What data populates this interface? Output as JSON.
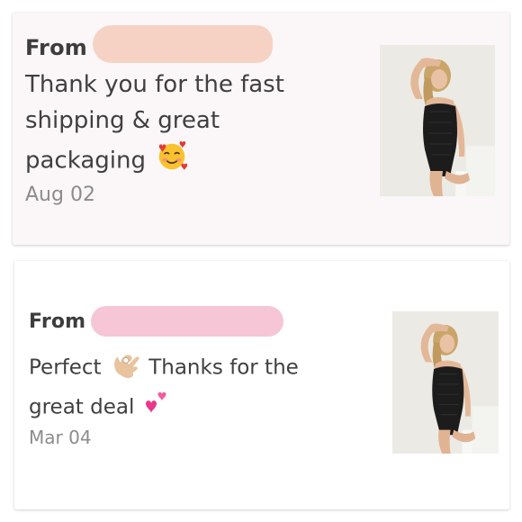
{
  "reviews": [
    {
      "from_label": "From",
      "message_text": "Thank you for the fast shipping & great packaging",
      "message_emoji": "smiling-face-with-hearts-icon",
      "date": "Aug 02"
    },
    {
      "from_label": "From",
      "message_part1": "Perfect",
      "emoji_1": "ok-hand-icon",
      "message_part2": "Thanks for the great deal",
      "emoji_2": "two-hearts-icon",
      "date": "Mar 04"
    }
  ],
  "colors": {
    "card1_background": "#fbf7f8",
    "card2_background": "#ffffff",
    "redaction_1": "#f6d2c5",
    "redaction_2": "#f7c6d6",
    "text": "#404040",
    "date_text": "#8c8c8c"
  }
}
